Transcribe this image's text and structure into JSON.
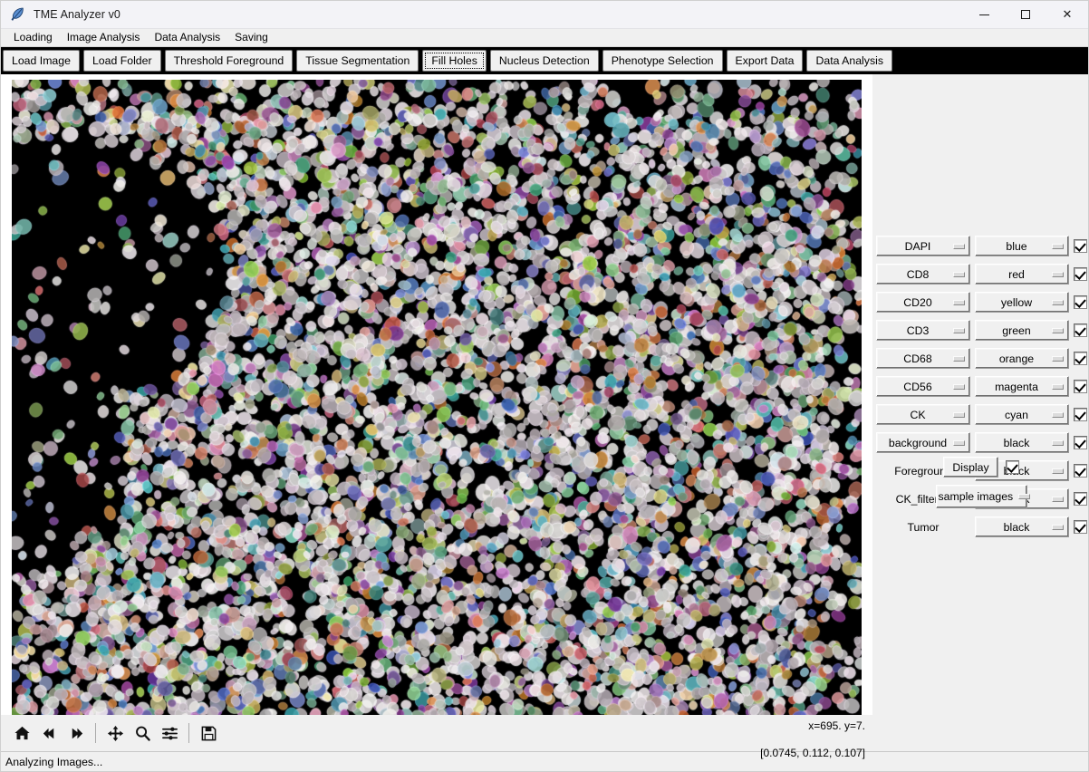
{
  "window": {
    "title": "TME Analyzer v0",
    "icon": "feather-icon",
    "minimize_label": "–",
    "maximize_label": "□",
    "close_label": "✕"
  },
  "menubar": {
    "items": [
      {
        "label": "Loading"
      },
      {
        "label": "Image Analysis"
      },
      {
        "label": "Data Analysis"
      },
      {
        "label": "Saving"
      }
    ]
  },
  "toolbar": {
    "buttons": [
      {
        "label": "Load Image",
        "focused": false
      },
      {
        "label": "Load Folder",
        "focused": false
      },
      {
        "label": "Threshold Foreground",
        "focused": false
      },
      {
        "label": "Tissue Segmentation",
        "focused": false
      },
      {
        "label": "Fill Holes",
        "focused": true
      },
      {
        "label": "Nucleus Detection",
        "focused": false
      },
      {
        "label": "Phenotype Selection",
        "focused": false
      },
      {
        "label": "Export Data",
        "focused": false
      },
      {
        "label": "Data Analysis",
        "focused": false
      }
    ]
  },
  "navtoolbar": {
    "buttons": [
      {
        "icon": "home-icon",
        "name": "home-button"
      },
      {
        "icon": "back-arrow-icon",
        "name": "back-button"
      },
      {
        "icon": "forward-arrow-icon",
        "name": "forward-button"
      },
      {
        "icon": "pan-move-icon",
        "name": "pan-button"
      },
      {
        "icon": "magnifier-icon",
        "name": "zoom-button"
      },
      {
        "icon": "sliders-icon",
        "name": "configure-subplots-button"
      },
      {
        "icon": "floppy-disk-icon",
        "name": "save-figure-button"
      }
    ],
    "coordinates_line1": "x=695. y=7.",
    "coordinates_line2": "[0.0745, 0.112, 0.107]"
  },
  "panel": {
    "rows": [
      {
        "type": "menu",
        "marker": "DAPI",
        "color": "blue",
        "checked": true
      },
      {
        "type": "menu",
        "marker": "CD8",
        "color": "red",
        "checked": true
      },
      {
        "type": "menu",
        "marker": "CD20",
        "color": "yellow",
        "checked": true
      },
      {
        "type": "menu",
        "marker": "CD3",
        "color": "green",
        "checked": true
      },
      {
        "type": "menu",
        "marker": "CD68",
        "color": "orange",
        "checked": true
      },
      {
        "type": "menu",
        "marker": "CD56",
        "color": "magenta",
        "checked": true
      },
      {
        "type": "menu",
        "marker": "CK",
        "color": "cyan",
        "checked": true
      },
      {
        "type": "menu",
        "marker": "background",
        "color": "black",
        "checked": true
      },
      {
        "type": "label",
        "marker": "Foreground",
        "color": "black",
        "checked": true
      },
      {
        "type": "label",
        "marker": "CK_filtered",
        "color": "black",
        "checked": true
      },
      {
        "type": "label",
        "marker": "Tumor",
        "color": "black",
        "checked": true
      }
    ],
    "display_button": "Display",
    "display_checked": true,
    "sample_menu_value": "sample images"
  },
  "statusbar": {
    "message": "Analyzing Images..."
  },
  "colors": {
    "panel_bg": "#f0f0f0",
    "toolbar_bg": "#000000",
    "canvas_bg": "#000000",
    "titlebar_bg": "#f3f3f7",
    "accent": "#0078d7"
  }
}
